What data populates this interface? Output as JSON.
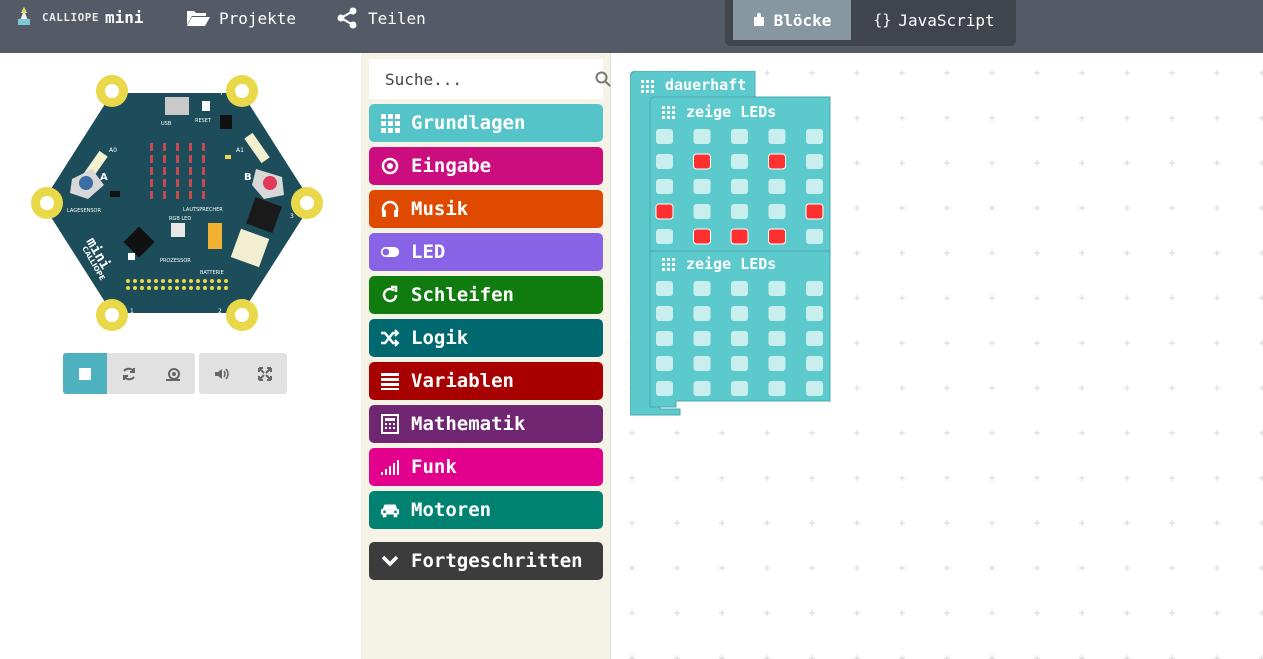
{
  "header": {
    "logo_brand": "CALLIOPE",
    "logo_mini": "mini",
    "projects_label": "Projekte",
    "share_label": "Teilen",
    "mode_blocks_label": "Blöcke",
    "mode_js_label": "JavaScript"
  },
  "simulator": {
    "board_labels": {
      "usb": "USB",
      "reset": "RESET",
      "a0": "A0",
      "a1": "A1",
      "button_a": "A",
      "button_b": "B",
      "lagesensor": "LAGESENSOR",
      "lautsprecher": "LAUTSPRECHER",
      "rgb_led": "RGB LED",
      "prozessor": "PROZESSOR",
      "batterie": "BATTERIE",
      "brand": "CALLIOPE",
      "mini": "mini",
      "pin_minus": "−",
      "pin_plus": "+",
      "pin_1": "1",
      "pin_2": "2",
      "pin_3": "3"
    },
    "controls": [
      "stop-icon",
      "restart-icon",
      "slow-icon",
      "sound-icon",
      "fullscreen-icon"
    ]
  },
  "toolbox": {
    "search_placeholder": "Suche...",
    "categories": [
      {
        "label": "Grundlagen",
        "color": "#54c4c9",
        "icon": "grid-icon"
      },
      {
        "label": "Eingabe",
        "color": "#cc0d80",
        "icon": "target-icon"
      },
      {
        "label": "Musik",
        "color": "#e04a00",
        "icon": "headphones-icon"
      },
      {
        "label": "LED",
        "color": "#8863e5",
        "icon": "toggle-icon"
      },
      {
        "label": "Schleifen",
        "color": "#107c10",
        "icon": "loop-icon"
      },
      {
        "label": "Logik",
        "color": "#006970",
        "icon": "shuffle-icon"
      },
      {
        "label": "Variablen",
        "color": "#a80000",
        "icon": "list-icon"
      },
      {
        "label": "Mathematik",
        "color": "#712672",
        "icon": "calculator-icon"
      },
      {
        "label": "Funk",
        "color": "#e3008c",
        "icon": "signal-icon"
      },
      {
        "label": "Motoren",
        "color": "#008272",
        "icon": "car-icon"
      }
    ],
    "advanced": {
      "label": "Fortgeschritten",
      "color": "#3c3c3c",
      "icon": "chevron-down-icon"
    }
  },
  "workspace": {
    "forever_label": "dauerhaft",
    "show_leds_1_label": "zeige LEDs",
    "show_leds_2_label": "zeige LEDs",
    "block_color": "#5cc9cc",
    "led_on_color": "#ff3030",
    "led_off_color": "#c9eeee",
    "leds_1": [
      [
        0,
        0,
        0,
        0,
        0
      ],
      [
        0,
        1,
        0,
        1,
        0
      ],
      [
        0,
        0,
        0,
        0,
        0
      ],
      [
        1,
        0,
        0,
        0,
        1
      ],
      [
        0,
        1,
        1,
        1,
        0
      ]
    ],
    "leds_2": [
      [
        0,
        0,
        0,
        0,
        0
      ],
      [
        0,
        0,
        0,
        0,
        0
      ],
      [
        0,
        0,
        0,
        0,
        0
      ],
      [
        0,
        0,
        0,
        0,
        0
      ],
      [
        0,
        0,
        0,
        0,
        0
      ]
    ]
  }
}
